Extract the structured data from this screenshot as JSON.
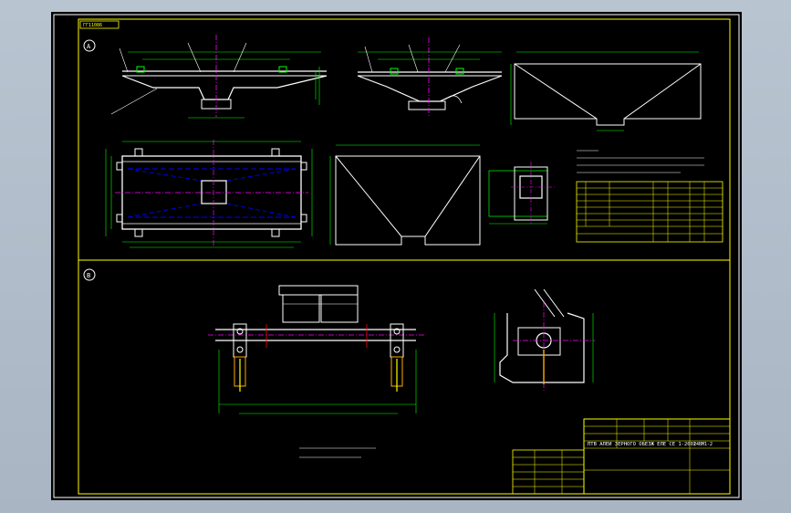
{
  "colors": {
    "background": "#aab6c4",
    "sheet": "#000000",
    "frame": "#ffff00",
    "outline": "#ffffff",
    "dimension": "#00ff00",
    "hidden": "#0000ff",
    "center": "#ff00ff",
    "hatch": "#ffaa00"
  },
  "drawing": {
    "title_tag": "ГГ11086",
    "section_a": "A",
    "section_b": "B",
    "title_block_title": "ПТВ АЛЕИ  ЗЕРНОГО ОБЕЗЖ ЕЛЕ СЕ 1-2002",
    "title_block_code": "14ВМ1-2"
  }
}
